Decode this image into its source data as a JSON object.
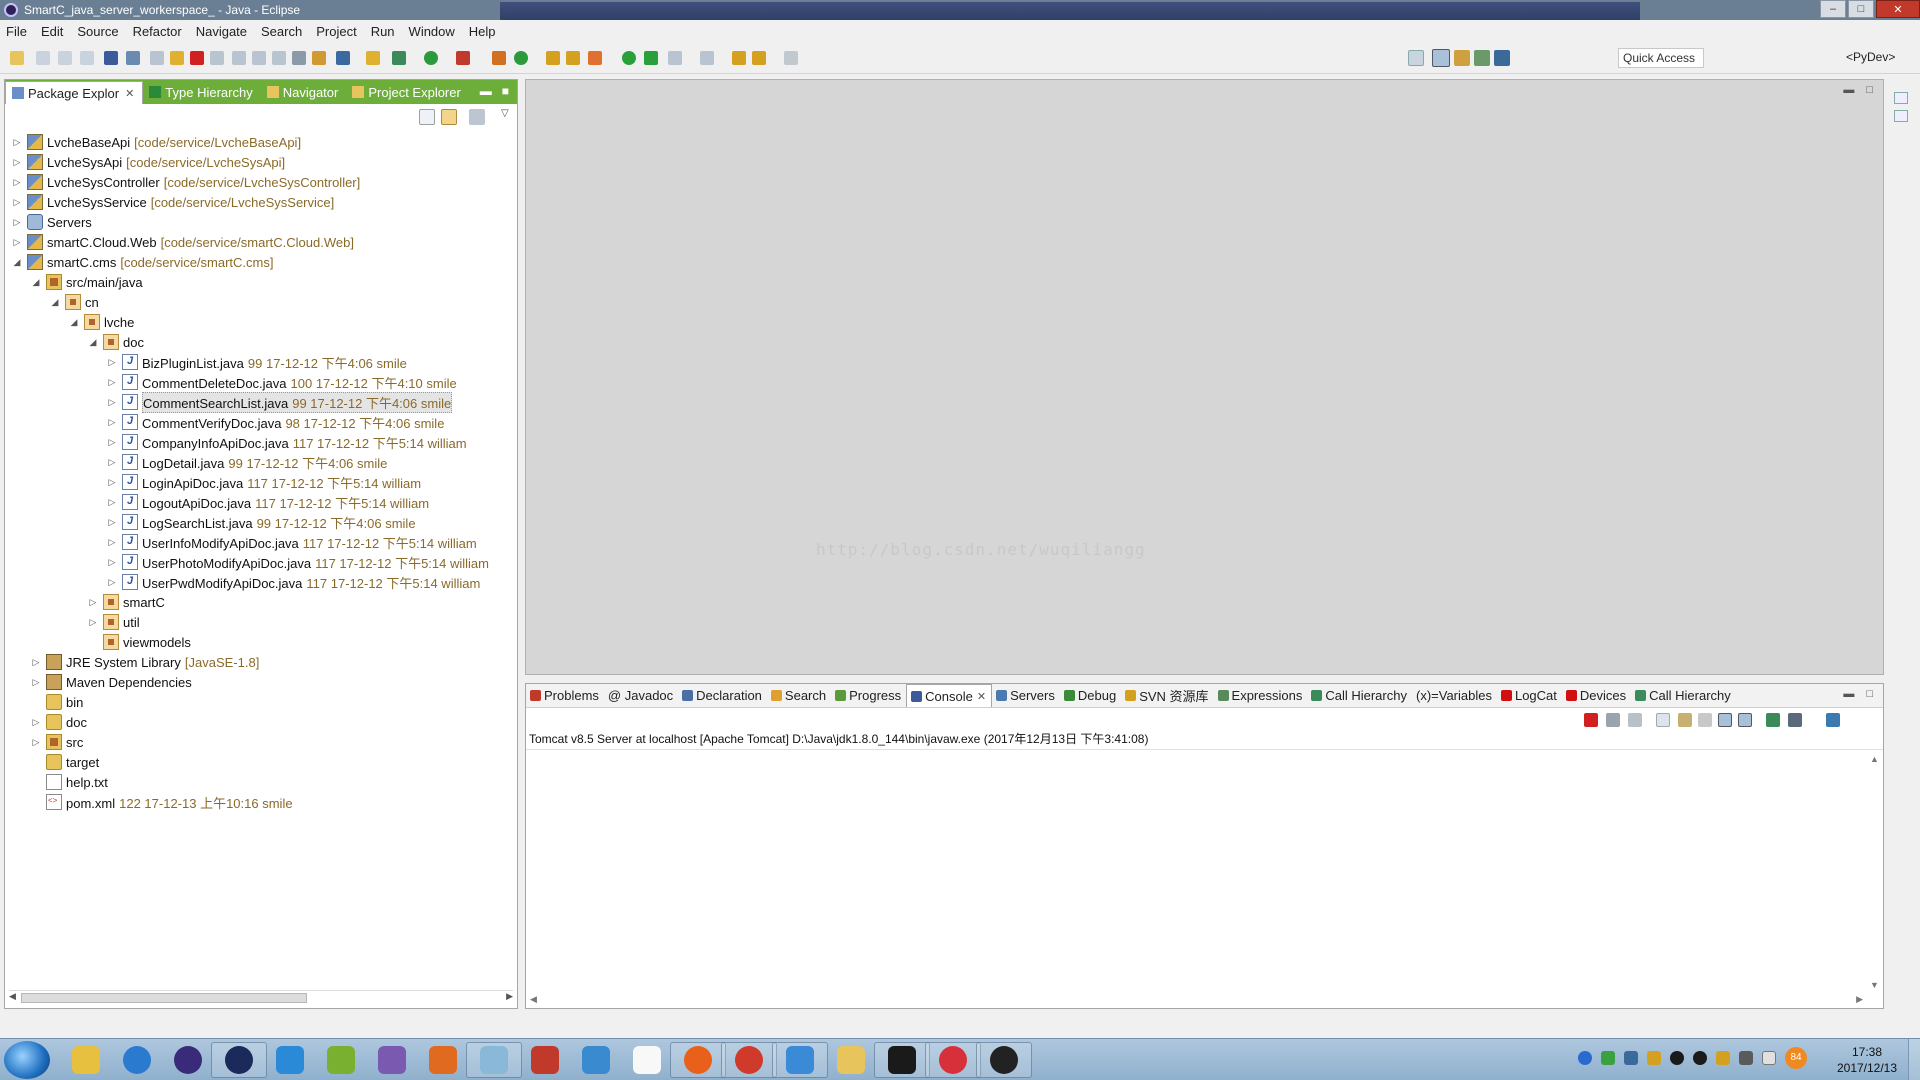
{
  "window": {
    "title": "SmartC_java_server_workerspace_ - Java - Eclipse",
    "controls": {
      "minimize": "–",
      "maximize": "□",
      "close": "✕"
    }
  },
  "menu": [
    "File",
    "Edit",
    "Source",
    "Refactor",
    "Navigate",
    "Search",
    "Project",
    "Run",
    "Window",
    "Help"
  ],
  "toolbar": {
    "quick_access": "Quick Access",
    "perspective": "<PyDev>"
  },
  "left_panel": {
    "tabs": [
      {
        "label": "Package Explor",
        "active": true,
        "closable": true
      },
      {
        "label": "Type Hierarchy",
        "active": false
      },
      {
        "label": "Navigator",
        "active": false
      },
      {
        "label": "Project Explorer",
        "active": false
      }
    ],
    "tree": [
      {
        "depth": 0,
        "twisty": "▷",
        "icon": "proj",
        "label": "LvcheBaseApi",
        "dec": "[code/service/LvcheBaseApi]"
      },
      {
        "depth": 0,
        "twisty": "▷",
        "icon": "proj",
        "label": "LvcheSysApi",
        "dec": "[code/service/LvcheSysApi]"
      },
      {
        "depth": 0,
        "twisty": "▷",
        "icon": "proj",
        "label": "LvcheSysController",
        "dec": "[code/service/LvcheSysController]"
      },
      {
        "depth": 0,
        "twisty": "▷",
        "icon": "proj",
        "label": "LvcheSysService",
        "dec": "[code/service/LvcheSysService]"
      },
      {
        "depth": 0,
        "twisty": "▷",
        "icon": "server",
        "label": "Servers",
        "dec": ""
      },
      {
        "depth": 0,
        "twisty": "▷",
        "icon": "proj",
        "label": "smartC.Cloud.Web",
        "dec": "[code/service/smartC.Cloud.Web]"
      },
      {
        "depth": 0,
        "twisty": "◢",
        "icon": "proj",
        "label": "smartC.cms",
        "dec": "[code/service/smartC.cms]"
      },
      {
        "depth": 1,
        "twisty": "◢",
        "icon": "srcfolder",
        "label": "src/main/java",
        "dec": ""
      },
      {
        "depth": 2,
        "twisty": "◢",
        "icon": "pkg",
        "label": "cn",
        "dec": ""
      },
      {
        "depth": 3,
        "twisty": "◢",
        "icon": "pkg",
        "label": "lvche",
        "dec": ""
      },
      {
        "depth": 4,
        "twisty": "◢",
        "icon": "pkg",
        "label": "doc",
        "dec": ""
      },
      {
        "depth": 5,
        "twisty": "▷",
        "icon": "java",
        "label": "BizPluginList.java",
        "dec": "99  17-12-12 下午4:06  smile"
      },
      {
        "depth": 5,
        "twisty": "▷",
        "icon": "java",
        "label": "CommentDeleteDoc.java",
        "dec": "100  17-12-12 下午4:10  smile"
      },
      {
        "depth": 5,
        "twisty": "▷",
        "icon": "java",
        "label": "CommentSearchList.java",
        "dec": "99  17-12-12 下午4:06  smile",
        "selected": true
      },
      {
        "depth": 5,
        "twisty": "▷",
        "icon": "java",
        "label": "CommentVerifyDoc.java",
        "dec": "98  17-12-12 下午4:06  smile"
      },
      {
        "depth": 5,
        "twisty": "▷",
        "icon": "java",
        "label": "CompanyInfoApiDoc.java",
        "dec": "117  17-12-12 下午5:14  william"
      },
      {
        "depth": 5,
        "twisty": "▷",
        "icon": "java",
        "label": "LogDetail.java",
        "dec": "99  17-12-12 下午4:06  smile"
      },
      {
        "depth": 5,
        "twisty": "▷",
        "icon": "java",
        "label": "LoginApiDoc.java",
        "dec": "117  17-12-12 下午5:14  william"
      },
      {
        "depth": 5,
        "twisty": "▷",
        "icon": "java",
        "label": "LogoutApiDoc.java",
        "dec": "117  17-12-12 下午5:14  william"
      },
      {
        "depth": 5,
        "twisty": "▷",
        "icon": "java",
        "label": "LogSearchList.java",
        "dec": "99  17-12-12 下午4:06  smile"
      },
      {
        "depth": 5,
        "twisty": "▷",
        "icon": "java",
        "label": "UserInfoModifyApiDoc.java",
        "dec": "117  17-12-12 下午5:14  william"
      },
      {
        "depth": 5,
        "twisty": "▷",
        "icon": "java",
        "label": "UserPhotoModifyApiDoc.java",
        "dec": "117  17-12-12 下午5:14  william"
      },
      {
        "depth": 5,
        "twisty": "▷",
        "icon": "java",
        "label": "UserPwdModifyApiDoc.java",
        "dec": "117  17-12-12 下午5:14  william"
      },
      {
        "depth": 4,
        "twisty": "▷",
        "icon": "pkg",
        "label": "smartC",
        "dec": ""
      },
      {
        "depth": 4,
        "twisty": "▷",
        "icon": "pkg",
        "label": "util",
        "dec": ""
      },
      {
        "depth": 4,
        "twisty": "",
        "icon": "pkg",
        "label": "viewmodels",
        "dec": ""
      },
      {
        "depth": 1,
        "twisty": "▷",
        "icon": "lib",
        "label": "JRE System Library",
        "dec": "[JavaSE-1.8]"
      },
      {
        "depth": 1,
        "twisty": "▷",
        "icon": "lib",
        "label": "Maven Dependencies",
        "dec": ""
      },
      {
        "depth": 1,
        "twisty": "",
        "icon": "folder",
        "label": "bin",
        "dec": ""
      },
      {
        "depth": 1,
        "twisty": "▷",
        "icon": "folder",
        "label": "doc",
        "dec": ""
      },
      {
        "depth": 1,
        "twisty": "▷",
        "icon": "srcfolder",
        "label": "src",
        "dec": ""
      },
      {
        "depth": 1,
        "twisty": "",
        "icon": "folder",
        "label": "target",
        "dec": ""
      },
      {
        "depth": 1,
        "twisty": "",
        "icon": "file",
        "label": "help.txt",
        "dec": ""
      },
      {
        "depth": 1,
        "twisty": "",
        "icon": "xml",
        "label": "pom.xml",
        "dec": "122  17-12-13 上午10:16  smile"
      }
    ]
  },
  "editor": {
    "watermark": "http://blog.csdn.net/wuqiliangg"
  },
  "bottom_panel": {
    "tabs": [
      {
        "label": "Problems",
        "color": "#c0392b"
      },
      {
        "label": "@ Javadoc",
        "color": ""
      },
      {
        "label": "Declaration",
        "color": "#4a6fa5"
      },
      {
        "label": "Search",
        "color": "#e0a030"
      },
      {
        "label": "Progress",
        "color": "#5a9a3a"
      },
      {
        "label": "Console",
        "color": "#3a5a9a",
        "active": true,
        "closable": true
      },
      {
        "label": "Servers",
        "color": "#4a7ab0"
      },
      {
        "label": "Debug",
        "color": "#3a8a3a"
      },
      {
        "label": "SVN 资源库",
        "color": "#d4a020"
      },
      {
        "label": "Expressions",
        "color": "#5a8a5a"
      },
      {
        "label": "Call Hierarchy",
        "color": "#3a8a5a"
      },
      {
        "label": "(x)=Variables",
        "color": ""
      },
      {
        "label": "LogCat",
        "color": "#d01010"
      },
      {
        "label": "Devices",
        "color": "#d01010"
      },
      {
        "label": "Call Hierarchy",
        "color": "#3a8a5a"
      }
    ],
    "console_label": "Tomcat v8.5 Server at localhost [Apache Tomcat] D:\\Java\\jdk1.8.0_144\\bin\\javaw.exe (2017年12月13日 下午3:41:08)"
  },
  "taskbar": {
    "apps": [
      "windows-explorer",
      "ie-blue",
      "eclipse-purple",
      "eclipse-dark",
      "ie",
      "android-studio",
      "visual-studio",
      "paint-brush",
      "notepad",
      "winrar",
      "network",
      "blank-doc",
      "firefox",
      "chrome",
      "feather-app",
      "folder",
      "cmd",
      "camera-app",
      "penguin-app"
    ],
    "tray_badge": "84",
    "clock_time": "17:38",
    "clock_date": "2017/12/13"
  },
  "colors": {
    "view_tab_accent": "#6dae3a",
    "titlebar": "#6b7f94",
    "editor_bg": "#d6d6d6"
  }
}
